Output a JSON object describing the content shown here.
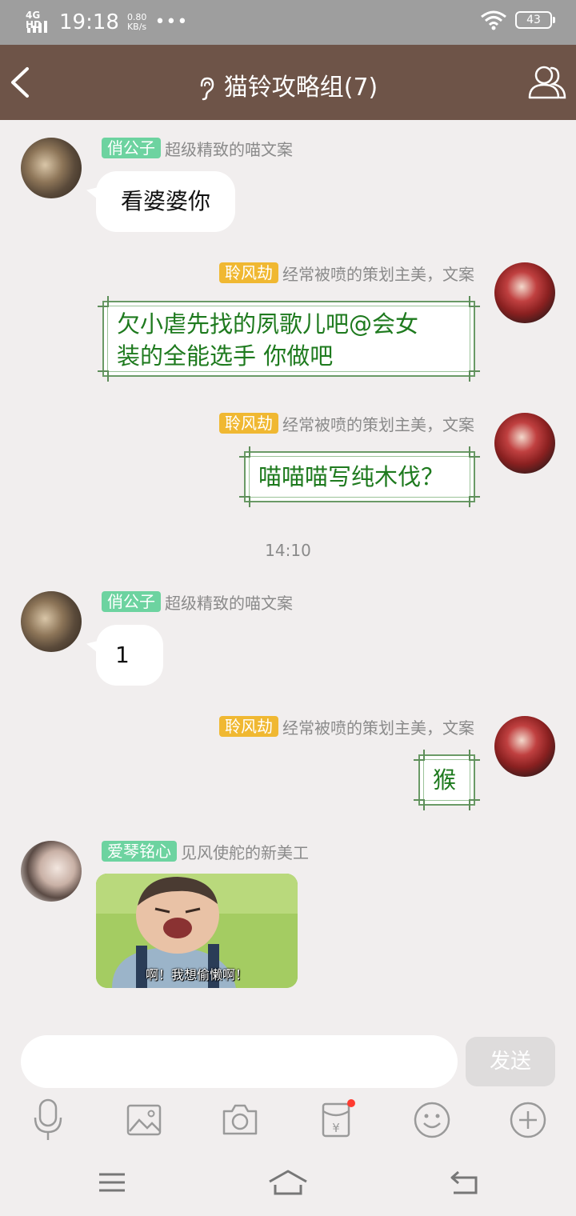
{
  "status_bar": {
    "network": "4G HD",
    "time": "19:18",
    "speed_value": "0.80",
    "speed_unit": "KB/s",
    "more": "•••",
    "battery": "43"
  },
  "header": {
    "title": "猫铃攻略组(7)",
    "icons": [
      "back-arrow-icon",
      "ear-icon",
      "group-members-icon"
    ]
  },
  "messages": [
    {
      "side": "left",
      "badge": "俏公子",
      "badge_color": "#6dd3a0",
      "subtitle": "超级精致的喵文案",
      "text": "看婆婆你"
    },
    {
      "side": "right",
      "badge": "聆风劫",
      "badge_color": "#f0b832",
      "subtitle": "经常被喷的策划主美，文案",
      "text_line1": "欠小虐先找的夙歌儿吧@会女",
      "text_line2": "装的全能选手  你做吧"
    },
    {
      "side": "right",
      "badge": "聆风劫",
      "badge_color": "#f0b832",
      "subtitle": "经常被喷的策划主美，文案",
      "text": "喵喵喵写纯木伐？"
    },
    {
      "side": "left",
      "badge": "俏公子",
      "badge_color": "#6dd3a0",
      "subtitle": "超级精致的喵文案",
      "text": "1"
    },
    {
      "side": "right",
      "badge": "聆风劫",
      "badge_color": "#f0b832",
      "subtitle": "经常被喷的策划主美，文案",
      "text": "猴"
    },
    {
      "side": "left",
      "badge": "爱琴铭心",
      "badge_color": "#6dd3a0",
      "subtitle": "见风使舵的新美工",
      "image_caption": "啊！我想偷懒啊！"
    }
  ],
  "time_separator": "14:10",
  "composer": {
    "input_value": "",
    "send_label": "发送"
  },
  "toolbar": [
    "microphone-icon",
    "image-icon",
    "camera-icon",
    "red-packet-icon",
    "emoji-icon",
    "plus-icon"
  ],
  "nav_bar": [
    "menu-icon",
    "home-icon",
    "back-icon"
  ],
  "colors": {
    "header_bg": "#6e5448",
    "status_bg": "#9e9e9e",
    "chat_bg": "#f1eeee",
    "bubble_text_green": "#1e7a1e",
    "notification_dot": "#ff3b30"
  }
}
